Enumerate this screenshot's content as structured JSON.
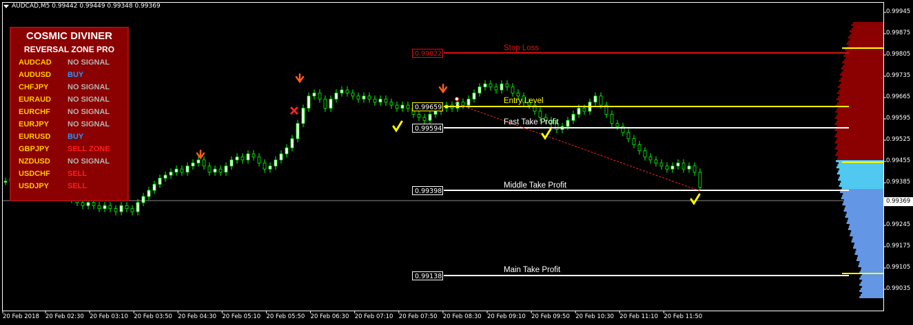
{
  "header": {
    "text": "AUDCAD,M5  0.99442 0.99449 0.99348 0.99369"
  },
  "panel": {
    "title": "COSMIC DIVINER",
    "subtitle": "REVERSAL ZONE PRO",
    "rows": [
      {
        "symbol": "AUDCAD",
        "signal": "NO SIGNAL",
        "color": "#b4b4b4"
      },
      {
        "symbol": "AUDUSD",
        "signal": "BUY",
        "color": "#1e9bff"
      },
      {
        "symbol": "CHFJPY",
        "signal": "NO SIGNAL",
        "color": "#b4b4b4"
      },
      {
        "symbol": "EURAUD",
        "signal": "NO SIGNAL",
        "color": "#b4b4b4"
      },
      {
        "symbol": "EURCHF",
        "signal": "NO SIGNAL",
        "color": "#b4b4b4"
      },
      {
        "symbol": "EURJPY",
        "signal": "NO SIGNAL",
        "color": "#b4b4b4"
      },
      {
        "symbol": "EURUSD",
        "signal": "BUY",
        "color": "#1e9bff"
      },
      {
        "symbol": "GBPJPY",
        "signal": "SELL ZONE",
        "color": "#ff1e1e"
      },
      {
        "symbol": "NZDUSD",
        "signal": "NO SIGNAL",
        "color": "#b4b4b4"
      },
      {
        "symbol": "USDCHF",
        "signal": "SELL",
        "color": "#ff1e1e"
      },
      {
        "symbol": "USDJPY",
        "signal": "SELL",
        "color": "#ff1e1e"
      }
    ]
  },
  "levels": [
    {
      "name": "Stop Loss",
      "price": "0.99822",
      "color": "#e01010"
    },
    {
      "name": "Entry Level",
      "price": "0.99659",
      "color": "#ffff00"
    },
    {
      "name": "Fast Take Profit",
      "price": "0.99594",
      "color": "#ffffff"
    },
    {
      "name": "Middle Take Profit",
      "price": "0.99398",
      "color": "#ffffff"
    },
    {
      "name": "Main Take Profit",
      "price": "0.99138",
      "color": "#ffffff"
    }
  ],
  "current_price": "0.99369",
  "y_axis": [
    "0.99945",
    "0.99875",
    "0.99805",
    "0.99735",
    "0.99665",
    "0.99595",
    "0.99525",
    "0.99455",
    "0.99385",
    "0.99315",
    "0.99245",
    "0.99175",
    "0.99105",
    "0.99035"
  ],
  "x_axis": [
    "20 Feb 2018",
    "20 Feb 02:30",
    "20 Feb 03:10",
    "20 Feb 03:50",
    "20 Feb 04:30",
    "20 Feb 05:10",
    "20 Feb 05:50",
    "20 Feb 06:30",
    "20 Feb 07:10",
    "20 Feb 07:50",
    "20 Feb 08:30",
    "20 Feb 09:10",
    "20 Feb 09:50",
    "20 Feb 10:30",
    "20 Feb 11:10",
    "20 Feb 11:50"
  ],
  "colors": {
    "bull_body": "#ffffff",
    "bear_body": "#000000",
    "wick": "#00ff00",
    "arrow": "#ff5a1e",
    "check": "#ffff00",
    "cross": "#ff2020",
    "profile_sell": "#8b0000",
    "profile_mid": "#50c8f0",
    "profile_buy": "#6496e6",
    "profile_line": "#ffff00"
  },
  "chart_data": {
    "type": "candlestick",
    "symbol": "AUDCAD",
    "timeframe": "M5",
    "ylim": [
      0.99005,
      0.99975
    ],
    "candles_close": [
      0.9939,
      0.994,
      0.9941,
      0.994,
      0.9939,
      0.9938,
      0.9937,
      0.9938,
      0.9939,
      0.9937,
      0.9936,
      0.9935,
      0.9933,
      0.9932,
      0.9931,
      0.9932,
      0.9931,
      0.993,
      0.9931,
      0.993,
      0.9929,
      0.9931,
      0.993,
      0.9929,
      0.9932,
      0.9934,
      0.9936,
      0.9938,
      0.994,
      0.9941,
      0.9942,
      0.9943,
      0.9942,
      0.9944,
      0.9945,
      0.9946,
      0.9944,
      0.9942,
      0.9943,
      0.9942,
      0.9944,
      0.9946,
      0.9947,
      0.9946,
      0.9948,
      0.9947,
      0.9945,
      0.9943,
      0.9944,
      0.9946,
      0.9948,
      0.995,
      0.9953,
      0.9958,
      0.9963,
      0.9967,
      0.9968,
      0.9966,
      0.9963,
      0.9966,
      0.9968,
      0.9969,
      0.9968,
      0.9967,
      0.9966,
      0.9967,
      0.9966,
      0.9965,
      0.9966,
      0.9965,
      0.9964,
      0.9963,
      0.9964,
      0.9963,
      0.9961,
      0.996,
      0.9959,
      0.9961,
      0.9962,
      0.9963,
      0.9964,
      0.9963,
      0.9965,
      0.9964,
      0.9966,
      0.9968,
      0.997,
      0.9971,
      0.997,
      0.9969,
      0.9971,
      0.997,
      0.9968,
      0.9967,
      0.9965,
      0.9964,
      0.9962,
      0.996,
      0.9959,
      0.9958,
      0.9956,
      0.9957,
      0.9959,
      0.9961,
      0.9963,
      0.9962,
      0.9965,
      0.9967,
      0.9964,
      0.9961,
      0.9958,
      0.9957,
      0.9955,
      0.9953,
      0.9951,
      0.9949,
      0.9947,
      0.9946,
      0.9945,
      0.9944,
      0.9943,
      0.9944,
      0.9945,
      0.9943,
      0.9944,
      0.9942,
      0.9937
    ]
  }
}
